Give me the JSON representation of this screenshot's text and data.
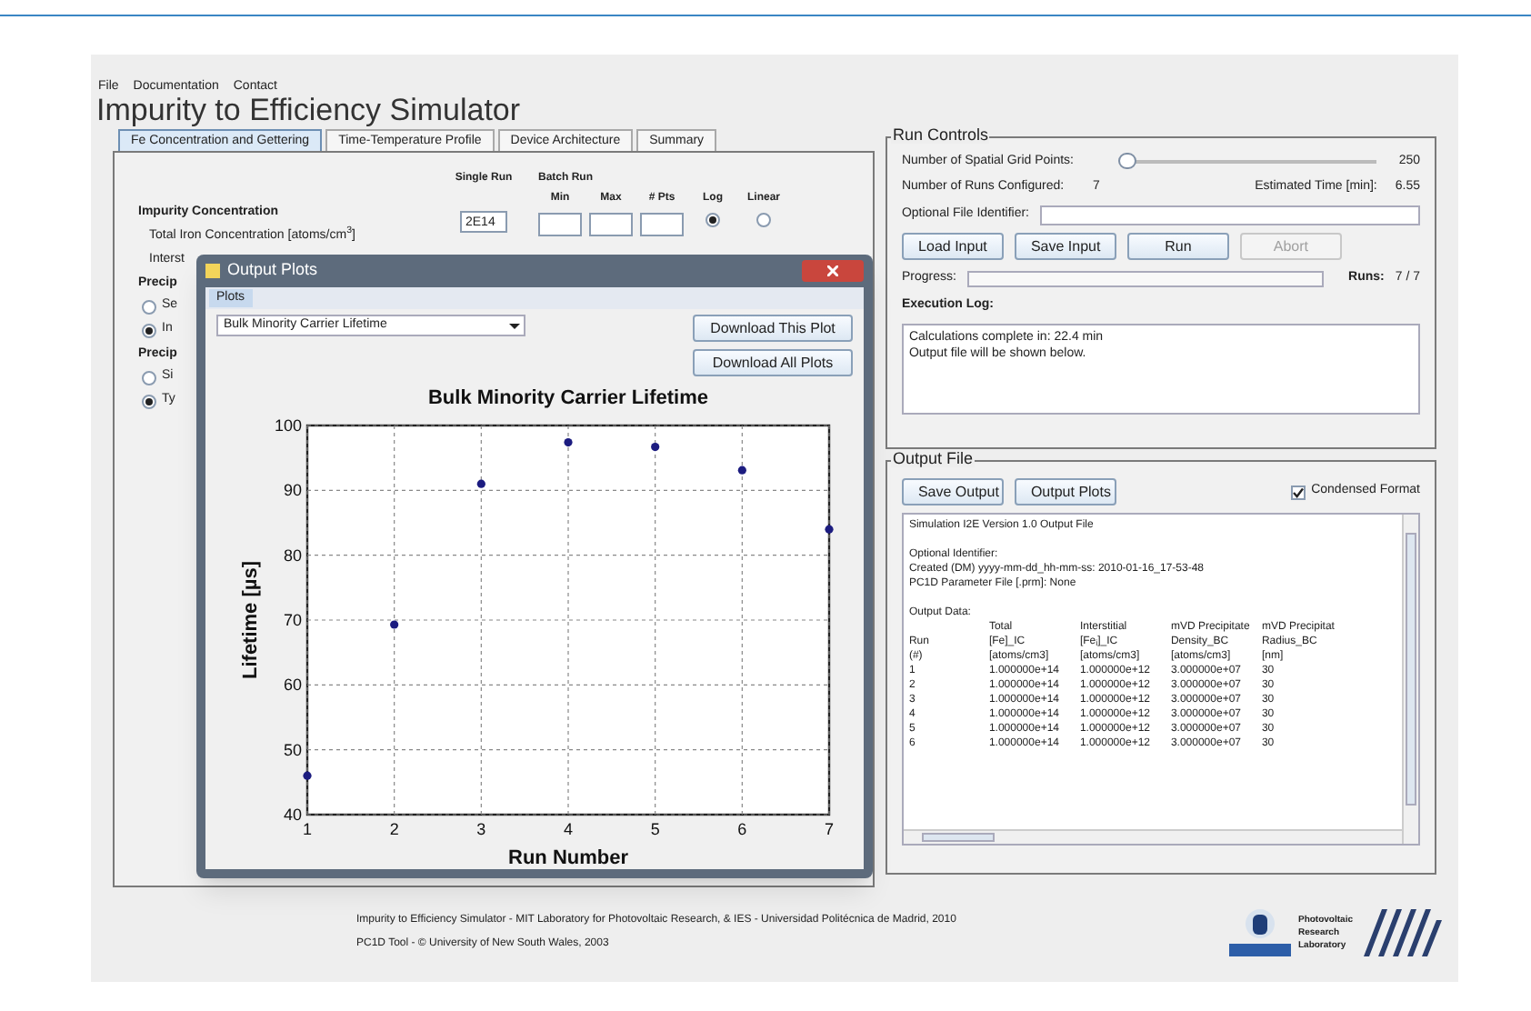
{
  "menu": [
    "File",
    "Documentation",
    "Contact"
  ],
  "app_title": "Impurity to Efficiency Simulator",
  "tabs": [
    {
      "label": "Fe Concentration and Gettering",
      "selected": true
    },
    {
      "label": "Time-Temperature Profile",
      "selected": false
    },
    {
      "label": "Device Architecture",
      "selected": false
    },
    {
      "label": "Summary",
      "selected": false
    }
  ],
  "concentration_panel": {
    "single_run_label": "Single Run",
    "batch_run_label": "Batch Run",
    "batch_columns": [
      "Min",
      "Max",
      "# Pts",
      "Log",
      "Linear"
    ],
    "section_title": "Impurity Concentration",
    "total_label": "Total Iron Concentration [atoms/cm$^{3}$]",
    "single_value": "2E14",
    "scale_radios": [
      {
        "selected": true
      },
      {
        "selected": false
      }
    ],
    "cut_rows": [
      {
        "kind": "text",
        "text": "Interst"
      },
      {
        "kind": "heading",
        "text": "Precip"
      },
      {
        "kind": "radio",
        "text": "Se",
        "selected": false
      },
      {
        "kind": "radio",
        "text": "In",
        "selected": true
      },
      {
        "kind": "heading",
        "text": "Precip"
      },
      {
        "kind": "radio",
        "text": "Si",
        "selected": false
      },
      {
        "kind": "radio",
        "text": "Ty",
        "selected": true
      }
    ]
  },
  "run_controls": {
    "title": "Run Controls",
    "grid_points_label": "Number of Spatial Grid Points:",
    "grid_points_slider": {
      "level": 0.02
    },
    "grid_points_value": "250",
    "runs_label": "Number of Runs Configured:",
    "runs_value": "7",
    "time_label": "Estimated Time [min]:",
    "time_value": "6.55",
    "identifier_label": "Optional File Identifier:",
    "buttons": [
      {
        "label": "Load Input",
        "disabled": false
      },
      {
        "label": "Save Input",
        "disabled": false
      },
      {
        "label": "Run",
        "disabled": false
      },
      {
        "label": "Abort",
        "disabled": true
      }
    ],
    "progress_label": "Progress:",
    "runs_progress_label": "Runs:",
    "runs_progress_value": "7 / 7",
    "log_label": "Execution Log:",
    "log_lines": [
      "Calculations complete in: 22.4 min",
      "Output file will be shown below."
    ]
  },
  "output_file": {
    "title": "Output File",
    "buttons": [
      "Save Output",
      "Output Plots"
    ],
    "condensed": {
      "label": "Condensed Format",
      "checked": true
    },
    "blocks": [
      [
        "Simulation I2E Version 1.0 Output File"
      ],
      [
        "Optional Identifier:",
        "Created (DM) yyyy-mm-dd_hh-mm-ss: 2010-01-16_17-53-48",
        "PC1D Parameter File [.prm]:     None"
      ],
      [
        "Output Data:"
      ]
    ],
    "table_columns": [
      [
        "Run",
        "(#)"
      ],
      [
        "Total",
        "[Fe]_IC",
        "[atoms/cm3]"
      ],
      [
        "Interstitial",
        "[Fe$_{i}$]_IC",
        "[atoms/cm3]"
      ],
      [
        "mVD Precipitate",
        "Density_BC",
        "[atoms/cm3]"
      ],
      [
        "mVD Precipitat",
        "Radius_BC",
        "[nm]"
      ]
    ],
    "table_rows": [
      [
        "1",
        "1.000000e+14",
        "1.000000e+12",
        "3.000000e+07",
        "30"
      ],
      [
        "2",
        "1.000000e+14",
        "1.000000e+12",
        "3.000000e+07",
        "30"
      ],
      [
        "3",
        "1.000000e+14",
        "1.000000e+12",
        "3.000000e+07",
        "30"
      ],
      [
        "4",
        "1.000000e+14",
        "1.000000e+12",
        "3.000000e+07",
        "30"
      ],
      [
        "5",
        "1.000000e+14",
        "1.000000e+12",
        "3.000000e+07",
        "30"
      ],
      [
        "6",
        "1.000000e+14",
        "1.000000e+12",
        "3.000000e+07",
        "30"
      ]
    ]
  },
  "plots_dialog": {
    "title": "Output Plots",
    "menu": "Plots",
    "plot_select": "Bulk Minority Carrier Lifetime",
    "buttons": [
      "Download This Plot",
      "Download All Plots"
    ],
    "chart_data": {
      "type": "scatter",
      "title": "Bulk Minority Carrier Lifetime",
      "xlabel": "Run Number",
      "ylabel": "Lifetime [µs]",
      "x": [
        1,
        2,
        3,
        4,
        5,
        6,
        7
      ],
      "grid": true,
      "series": [
        {
          "color": "#1c1c80",
          "values": [
            46,
            69.3,
            91,
            97.4,
            96.7,
            93.1,
            84
          ]
        }
      ],
      "xlim": [
        1,
        7
      ],
      "ylim": [
        40,
        100
      ],
      "xticks": [
        1,
        2,
        3,
        4,
        5,
        6,
        7
      ],
      "yticks": [
        40,
        50,
        60,
        70,
        80,
        90,
        100
      ]
    }
  },
  "footer": {
    "lines": [
      "Impurity to Efficiency Simulator - MIT Laboratory for Photovoltaic Research, & IES - Universidad Politécnica de Madrid, 2010",
      "PC1D Tool - © University of New South Wales, 2003"
    ],
    "logo_text": [
      "Photovoltaic",
      "Research",
      "Laboratory"
    ]
  }
}
